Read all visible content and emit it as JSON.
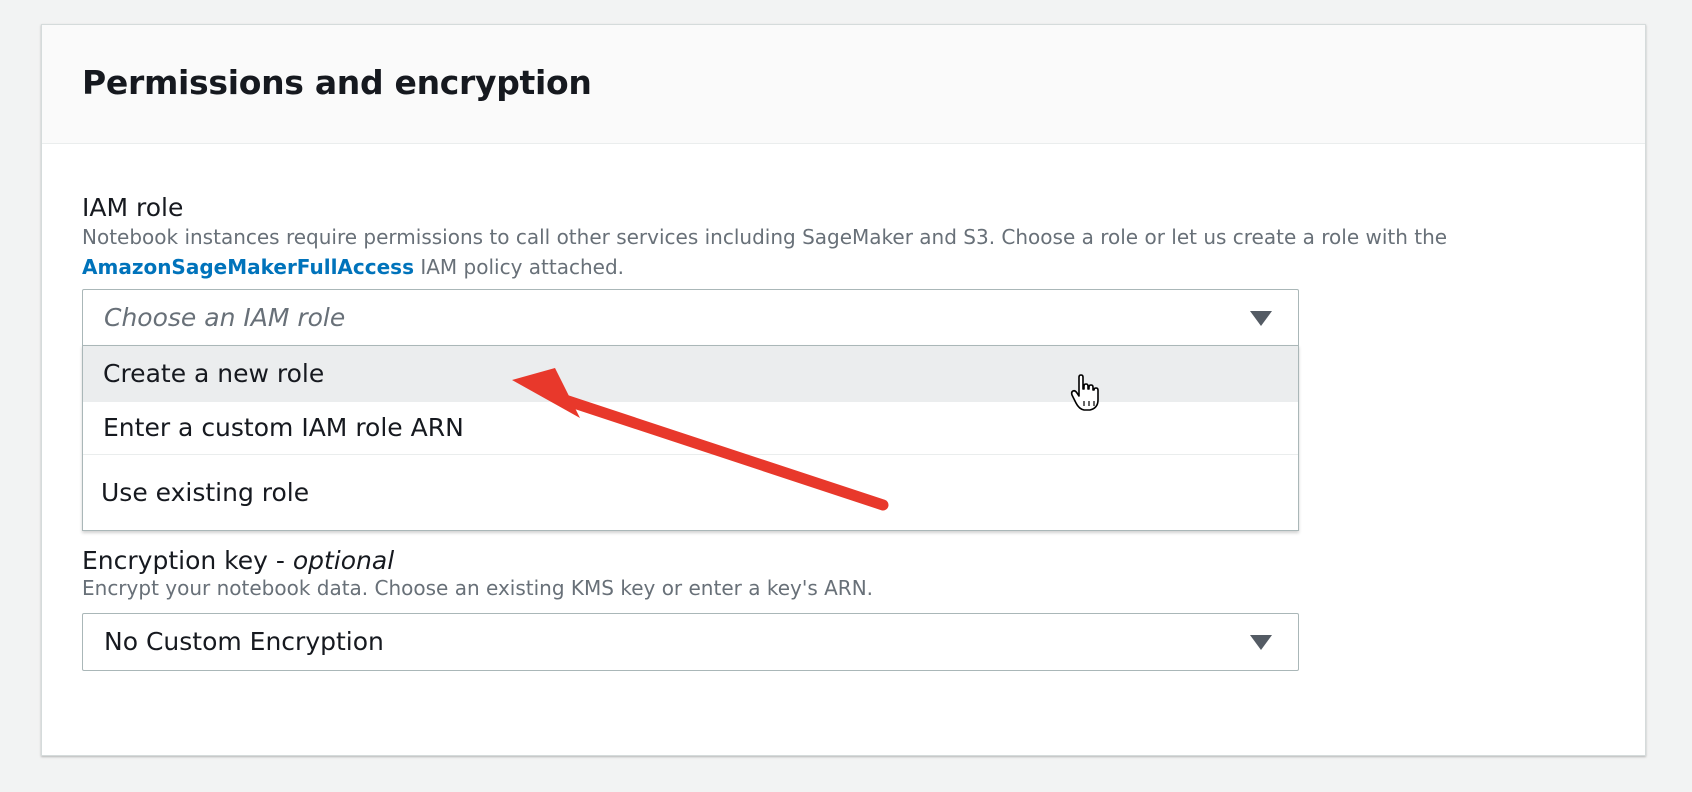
{
  "section": {
    "title": "Permissions and encryption"
  },
  "iam_role": {
    "label": "IAM role",
    "description_line1": "Notebook instances require permissions to call other services including SageMaker and S3. Choose a role or let us create a role with the",
    "policy_link": "AmazonSageMakerFullAccess",
    "description_line2_suffix": " IAM policy attached.",
    "select": {
      "placeholder": "Choose an IAM role"
    },
    "options": [
      {
        "label": "Create a new role",
        "state": "hovered"
      },
      {
        "label": "Enter a custom IAM role ARN"
      },
      {
        "label": "Use existing role"
      }
    ]
  },
  "encryption": {
    "label_main": "Encryption key - ",
    "label_optional": "optional",
    "description": "Encrypt your notebook data. Choose an existing KMS key or enter a key's ARN.",
    "select": {
      "value": "No Custom Encryption"
    }
  },
  "icons": {
    "dropdown": "triangle-down-icon",
    "cursor": "hand-pointer-icon",
    "annotation": "red-arrow-annotation"
  },
  "colors": {
    "link": "#0073bb",
    "annotation_arrow": "#e8382b",
    "hover_background": "#ebedee",
    "page_background": "#f2f3f3"
  }
}
